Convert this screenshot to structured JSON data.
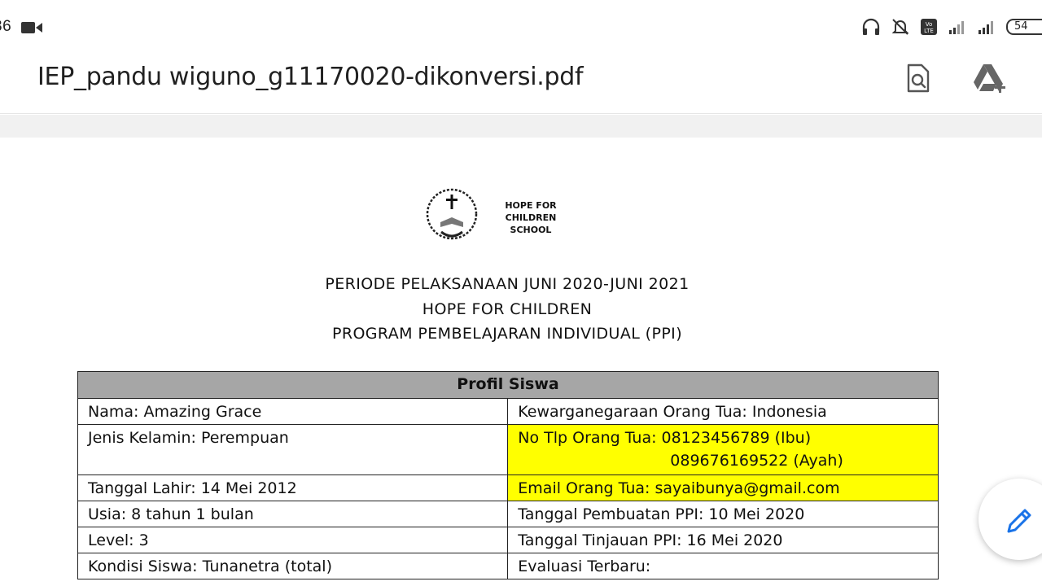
{
  "status_bar": {
    "time_fragment": "36",
    "icons": [
      "video-camera-icon",
      "headphones-icon",
      "mute-icon",
      "volte-icon",
      "signal-icon",
      "signal-icon",
      "battery-icon"
    ],
    "battery": "54"
  },
  "app_bar": {
    "title": "IEP_pandu wiguno_g11170020-dikonversi.pdf",
    "actions": [
      "search-document-icon",
      "add-to-drive-icon"
    ]
  },
  "document": {
    "logo_text_line1": "HOPE FOR CHILDREN",
    "logo_text_line2": "SCHOOL",
    "heading_line1": "PERIODE PELAKSANAAN JUNI 2020-JUNI 2021",
    "heading_line2": "HOPE FOR CHILDREN",
    "heading_line3": "PROGRAM PEMBELAJARAN INDIVIDUAL (PPI)",
    "table": {
      "header": "Profil Siswa",
      "rows": [
        {
          "left": "Nama: Amazing Grace",
          "right": "Kewarganegaraan Orang Tua: Indonesia"
        },
        {
          "left": "Jenis Kelamin: Perempuan",
          "right": "No Tlp Orang Tua: 08123456789 (Ibu)",
          "right_line2": "089676169522 (Ayah)"
        },
        {
          "left": "Tanggal Lahir: 14 Mei 2012",
          "right": "Email Orang Tua: sayaibunya@gmail.com"
        },
        {
          "left": "Usia: 8 tahun 1 bulan",
          "right": "Tanggal Pembuatan PPI: 10 Mei 2020"
        },
        {
          "left": "Level: 3",
          "right": "Tanggal Tinjauan PPI: 16 Mei 2020"
        },
        {
          "left": "Kondisi Siswa: Tunanetra (total)",
          "right": "Evaluasi Terbaru:"
        }
      ],
      "highlight_color": "#ffff00",
      "header_bg": "#a6a6a6"
    }
  },
  "fab": {
    "icon": "edit-pencil-icon",
    "color": "#1a73e8"
  }
}
